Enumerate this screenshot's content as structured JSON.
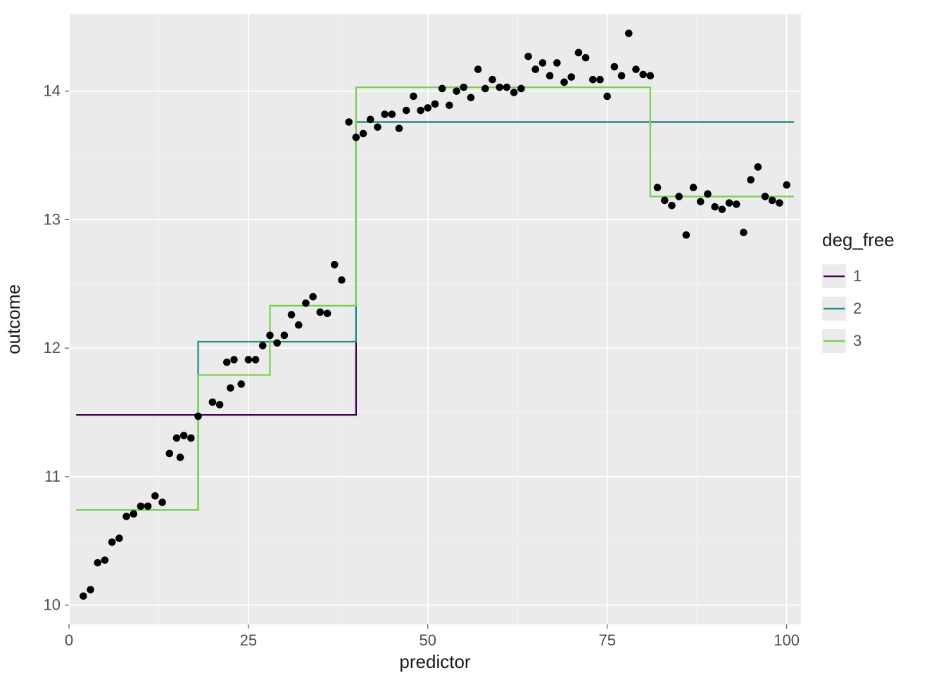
{
  "chart_data": {
    "type": "scatter",
    "xlabel": "predictor",
    "ylabel": "outcome",
    "xlim": [
      0,
      102
    ],
    "ylim": [
      9.85,
      14.6
    ],
    "x_ticks": [
      0,
      25,
      50,
      75,
      100
    ],
    "x_minor": [
      12.5,
      37.5,
      62.5,
      87.5
    ],
    "y_ticks": [
      10,
      11,
      12,
      13,
      14
    ],
    "y_minor": [
      10.5,
      11.5,
      12.5,
      13.5
    ],
    "legend_title": "deg_free",
    "colors": {
      "1": "#440154",
      "2": "#21908c",
      "3": "#7ad151"
    },
    "points": [
      {
        "x": 2,
        "y": 10.07
      },
      {
        "x": 3,
        "y": 10.12
      },
      {
        "x": 4,
        "y": 10.33
      },
      {
        "x": 5,
        "y": 10.35
      },
      {
        "x": 6,
        "y": 10.49
      },
      {
        "x": 7,
        "y": 10.52
      },
      {
        "x": 8,
        "y": 10.69
      },
      {
        "x": 9,
        "y": 10.71
      },
      {
        "x": 10,
        "y": 10.77
      },
      {
        "x": 11,
        "y": 10.77
      },
      {
        "x": 12,
        "y": 10.85
      },
      {
        "x": 13,
        "y": 10.8
      },
      {
        "x": 14,
        "y": 11.18
      },
      {
        "x": 15,
        "y": 11.3
      },
      {
        "x": 15.5,
        "y": 11.15
      },
      {
        "x": 16,
        "y": 11.32
      },
      {
        "x": 17,
        "y": 11.3
      },
      {
        "x": 18,
        "y": 11.47
      },
      {
        "x": 20,
        "y": 11.58
      },
      {
        "x": 21,
        "y": 11.56
      },
      {
        "x": 22,
        "y": 11.89
      },
      {
        "x": 22.5,
        "y": 11.69
      },
      {
        "x": 23,
        "y": 11.91
      },
      {
        "x": 24,
        "y": 11.72
      },
      {
        "x": 25,
        "y": 11.91
      },
      {
        "x": 26,
        "y": 11.91
      },
      {
        "x": 27,
        "y": 12.02
      },
      {
        "x": 28,
        "y": 12.1
      },
      {
        "x": 29,
        "y": 12.04
      },
      {
        "x": 30,
        "y": 12.1
      },
      {
        "x": 31,
        "y": 12.26
      },
      {
        "x": 32,
        "y": 12.18
      },
      {
        "x": 33,
        "y": 12.35
      },
      {
        "x": 34,
        "y": 12.4
      },
      {
        "x": 35,
        "y": 12.28
      },
      {
        "x": 36,
        "y": 12.27
      },
      {
        "x": 37,
        "y": 12.65
      },
      {
        "x": 38,
        "y": 12.53
      },
      {
        "x": 39,
        "y": 13.76
      },
      {
        "x": 40,
        "y": 13.64
      },
      {
        "x": 41,
        "y": 13.67
      },
      {
        "x": 42,
        "y": 13.78
      },
      {
        "x": 43,
        "y": 13.72
      },
      {
        "x": 44,
        "y": 13.82
      },
      {
        "x": 45,
        "y": 13.82
      },
      {
        "x": 46,
        "y": 13.71
      },
      {
        "x": 47,
        "y": 13.85
      },
      {
        "x": 48,
        "y": 13.96
      },
      {
        "x": 49,
        "y": 13.85
      },
      {
        "x": 50,
        "y": 13.87
      },
      {
        "x": 51,
        "y": 13.9
      },
      {
        "x": 52,
        "y": 14.02
      },
      {
        "x": 53,
        "y": 13.89
      },
      {
        "x": 54,
        "y": 14.0
      },
      {
        "x": 55,
        "y": 14.03
      },
      {
        "x": 56,
        "y": 13.95
      },
      {
        "x": 57,
        "y": 14.17
      },
      {
        "x": 58,
        "y": 14.02
      },
      {
        "x": 59,
        "y": 14.09
      },
      {
        "x": 60,
        "y": 14.03
      },
      {
        "x": 61,
        "y": 14.03
      },
      {
        "x": 62,
        "y": 13.99
      },
      {
        "x": 63,
        "y": 14.02
      },
      {
        "x": 64,
        "y": 14.27
      },
      {
        "x": 65,
        "y": 14.17
      },
      {
        "x": 66,
        "y": 14.22
      },
      {
        "x": 67,
        "y": 14.12
      },
      {
        "x": 68,
        "y": 14.22
      },
      {
        "x": 69,
        "y": 14.07
      },
      {
        "x": 70,
        "y": 14.11
      },
      {
        "x": 71,
        "y": 14.3
      },
      {
        "x": 72,
        "y": 14.26
      },
      {
        "x": 73,
        "y": 14.09
      },
      {
        "x": 74,
        "y": 14.09
      },
      {
        "x": 75,
        "y": 13.96
      },
      {
        "x": 76,
        "y": 14.19
      },
      {
        "x": 77,
        "y": 14.12
      },
      {
        "x": 78,
        "y": 14.45
      },
      {
        "x": 79,
        "y": 14.17
      },
      {
        "x": 80,
        "y": 14.13
      },
      {
        "x": 81,
        "y": 14.12
      },
      {
        "x": 82,
        "y": 13.25
      },
      {
        "x": 83,
        "y": 13.15
      },
      {
        "x": 84,
        "y": 13.11
      },
      {
        "x": 85,
        "y": 13.18
      },
      {
        "x": 86,
        "y": 12.88
      },
      {
        "x": 87,
        "y": 13.25
      },
      {
        "x": 88,
        "y": 13.14
      },
      {
        "x": 89,
        "y": 13.2
      },
      {
        "x": 90,
        "y": 13.1
      },
      {
        "x": 91,
        "y": 13.08
      },
      {
        "x": 92,
        "y": 13.13
      },
      {
        "x": 93,
        "y": 13.12
      },
      {
        "x": 94,
        "y": 12.9
      },
      {
        "x": 95,
        "y": 13.31
      },
      {
        "x": 96,
        "y": 13.41
      },
      {
        "x": 97,
        "y": 13.18
      },
      {
        "x": 98,
        "y": 13.15
      },
      {
        "x": 99,
        "y": 13.13
      },
      {
        "x": 100,
        "y": 13.27
      }
    ],
    "series": [
      {
        "name": "1",
        "type": "step",
        "breaks": [
          {
            "from": 1,
            "to": 40,
            "y": 11.48
          },
          {
            "from": 40,
            "to": 101,
            "y": 13.76
          }
        ]
      },
      {
        "name": "2",
        "type": "step",
        "breaks": [
          {
            "from": 1,
            "to": 18,
            "y": 10.74
          },
          {
            "from": 18,
            "to": 40,
            "y": 12.05
          },
          {
            "from": 40,
            "to": 101,
            "y": 13.76
          }
        ]
      },
      {
        "name": "3",
        "type": "step",
        "breaks": [
          {
            "from": 1,
            "to": 18,
            "y": 10.74
          },
          {
            "from": 18,
            "to": 28,
            "y": 11.79
          },
          {
            "from": 28,
            "to": 40,
            "y": 12.33
          },
          {
            "from": 40,
            "to": 81,
            "y": 14.03
          },
          {
            "from": 81,
            "to": 101,
            "y": 13.18
          }
        ]
      }
    ]
  },
  "legend": {
    "title": "deg_free",
    "items": [
      {
        "label": "1",
        "color": "#440154"
      },
      {
        "label": "2",
        "color": "#21908c"
      },
      {
        "label": "3",
        "color": "#7ad151"
      }
    ]
  }
}
